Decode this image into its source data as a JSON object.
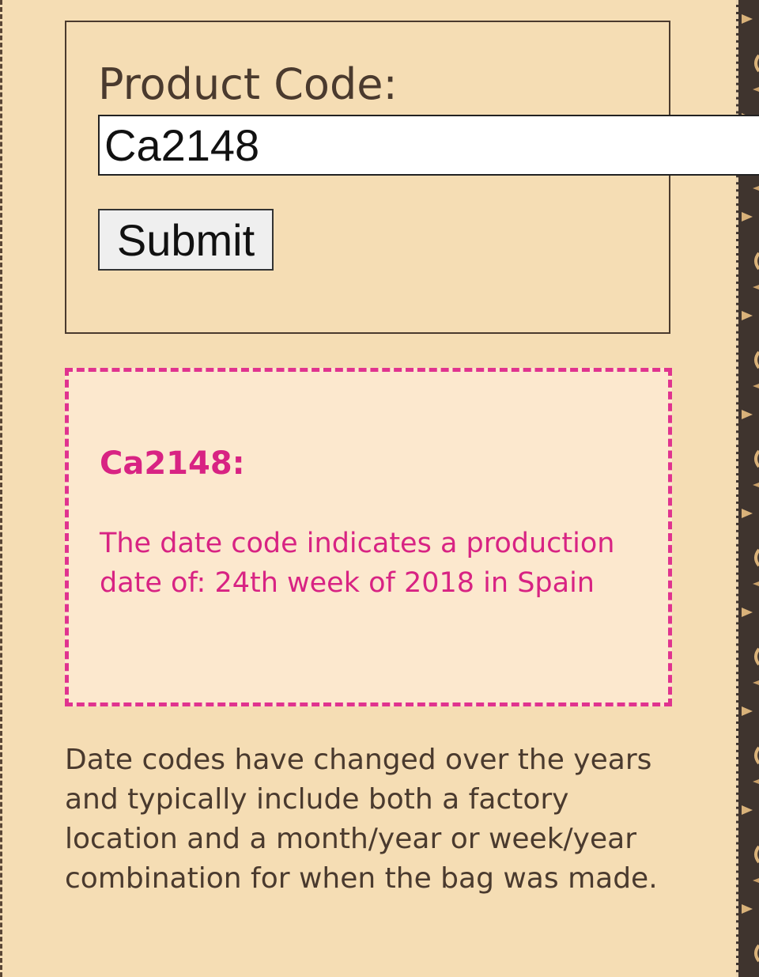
{
  "form": {
    "label": "Product Code:",
    "input_value": "Ca2148",
    "input_placeholder": "",
    "submit_label": "Submit"
  },
  "result": {
    "code_heading": "Ca2148:",
    "message": "The date code indicates a production date of: 24th week of 2018 in Spain"
  },
  "info": {
    "text": "Date codes have changed over the years and typically include both a factory location and a month/year or week/year combination for when the bag was made."
  },
  "colors": {
    "page_background": "#f5ddb4",
    "result_accent": "#d82383",
    "result_background": "#fce8ce",
    "text_dark": "#4a3a2e",
    "strip_dark": "#3f342e"
  }
}
